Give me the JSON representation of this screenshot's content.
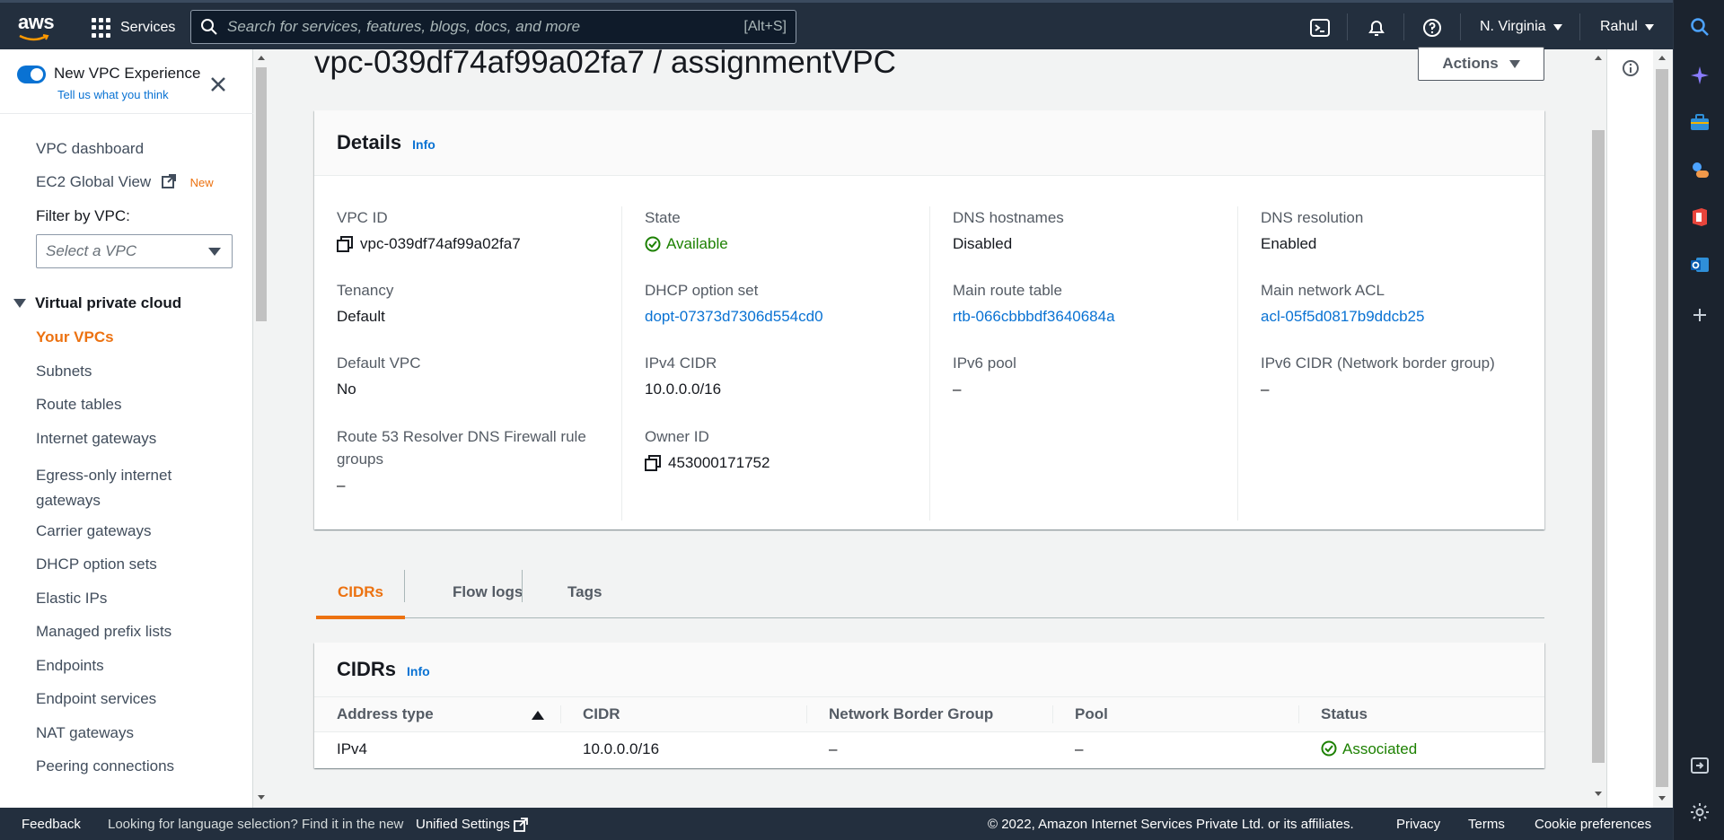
{
  "topnav": {
    "logo_text": "aws",
    "services_label": "Services",
    "search_placeholder": "Search for services, features, blogs, docs, and more",
    "search_shortcut": "[Alt+S]",
    "region": "N. Virginia",
    "user": "Rahul"
  },
  "sidebar": {
    "toggle_label": "New VPC Experience",
    "feedback_link": "Tell us what you think",
    "links_top": [
      {
        "label": "VPC dashboard"
      },
      {
        "label": "EC2 Global View",
        "badge": "New"
      }
    ],
    "filter_label": "Filter by VPC:",
    "filter_placeholder": "Select a VPC",
    "section_title": "Virtual private cloud",
    "section_items": [
      {
        "label": "Your VPCs",
        "active": true
      },
      {
        "label": "Subnets"
      },
      {
        "label": "Route tables"
      },
      {
        "label": "Internet gateways"
      },
      {
        "label": "Egress-only internet gateways"
      },
      {
        "label": "Carrier gateways"
      },
      {
        "label": "DHCP option sets"
      },
      {
        "label": "Elastic IPs"
      },
      {
        "label": "Managed prefix lists"
      },
      {
        "label": "Endpoints"
      },
      {
        "label": "Endpoint services"
      },
      {
        "label": "NAT gateways"
      },
      {
        "label": "Peering connections"
      }
    ]
  },
  "page": {
    "title": "vpc-039df74af99a02fa7 / assignmentVPC",
    "actions_label": "Actions"
  },
  "details": {
    "title": "Details",
    "info": "Info",
    "fields": {
      "vpc_id": {
        "label": "VPC ID",
        "value": "vpc-039df74af99a02fa7"
      },
      "state": {
        "label": "State",
        "value": "Available"
      },
      "dns_hostnames": {
        "label": "DNS hostnames",
        "value": "Disabled"
      },
      "dns_resolution": {
        "label": "DNS resolution",
        "value": "Enabled"
      },
      "tenancy": {
        "label": "Tenancy",
        "value": "Default"
      },
      "dhcp": {
        "label": "DHCP option set",
        "value": "dopt-07373d7306d554cd0"
      },
      "main_route": {
        "label": "Main route table",
        "value": "rtb-066cbbbdf3640684a"
      },
      "main_acl": {
        "label": "Main network ACL",
        "value": "acl-05f5d0817b9ddcb25"
      },
      "default_vpc": {
        "label": "Default VPC",
        "value": "No"
      },
      "ipv4_cidr": {
        "label": "IPv4 CIDR",
        "value": "10.0.0.0/16"
      },
      "ipv6_pool": {
        "label": "IPv6 pool",
        "value": "–"
      },
      "ipv6_cidr": {
        "label": "IPv6 CIDR (Network border group)",
        "value": "–"
      },
      "route53": {
        "label": "Route 53 Resolver DNS Firewall rule groups",
        "value": "–"
      },
      "owner_id": {
        "label": "Owner ID",
        "value": "453000171752"
      }
    }
  },
  "tabs": [
    "CIDRs",
    "Flow logs",
    "Tags"
  ],
  "cidrs": {
    "title": "CIDRs",
    "info": "Info",
    "columns": [
      "Address type",
      "CIDR",
      "Network Border Group",
      "Pool",
      "Status"
    ],
    "rows": [
      {
        "address_type": "IPv4",
        "cidr": "10.0.0.0/16",
        "nbg": "–",
        "pool": "–",
        "status": "Associated"
      }
    ]
  },
  "footer": {
    "feedback": "Feedback",
    "lang_text": "Looking for language selection? Find it in the new",
    "unified": "Unified Settings",
    "copyright": "© 2022, Amazon Internet Services Private Ltd. or its affiliates.",
    "privacy": "Privacy",
    "terms": "Terms",
    "cookies": "Cookie preferences"
  },
  "colors": {
    "nav_bg": "#232f3e",
    "accent_orange": "#ec7211",
    "link_blue": "#0972d3",
    "success_green": "#1d8102"
  }
}
